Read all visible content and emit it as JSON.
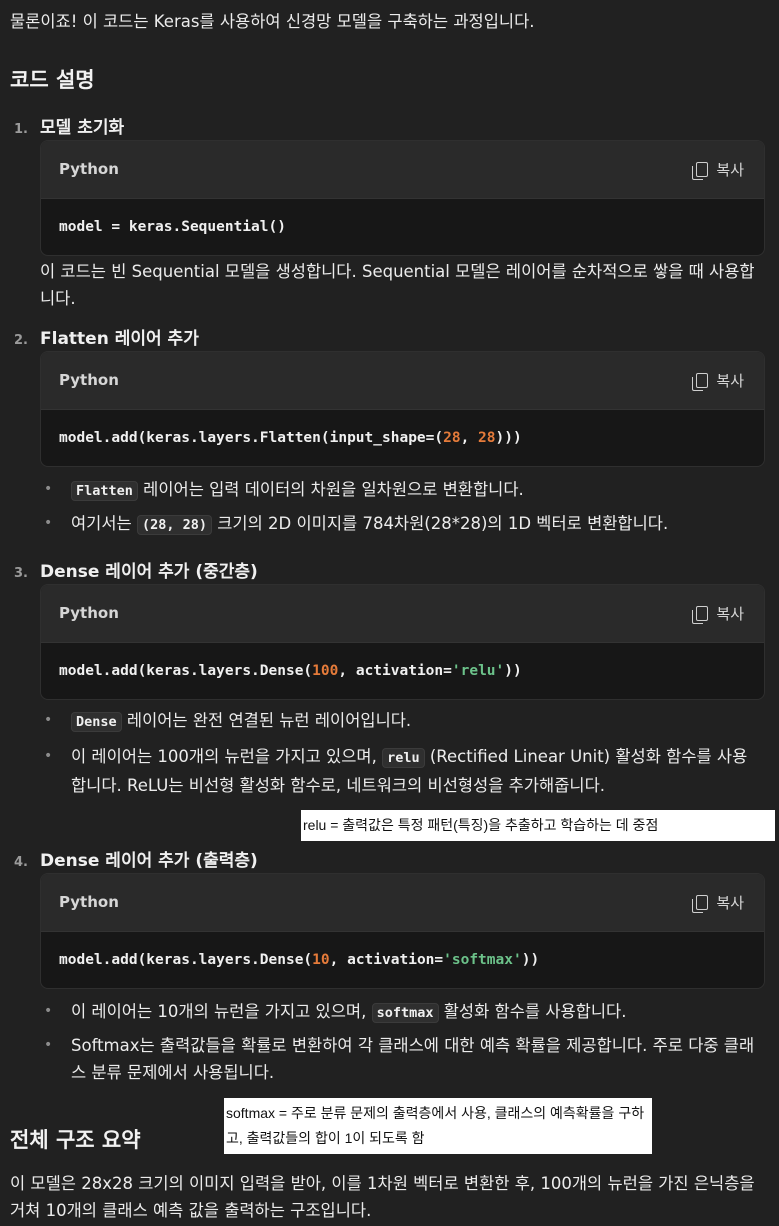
{
  "intro": "물론이죠! 이 코드는 Keras를 사용하여 신경망 모델을 구축하는 과정입니다.",
  "section_code_title": "코드 설명",
  "steps": [
    {
      "num": "1.",
      "title": "모델 초기화",
      "code_lang": "Python",
      "copy_label": "복사",
      "code": "model = keras.Sequential()",
      "desc": "이 코드는 빈 Sequential 모델을 생성합니다. Sequential 모델은 레이어를 순차적으로 쌓을 때 사용합니다."
    },
    {
      "num": "2.",
      "title": "Flatten 레이어 추가",
      "code_lang": "Python",
      "copy_label": "복사",
      "code_prefix": "model.add(keras.layers.Flatten(input_shape=(",
      "code_num1": "28",
      "code_mid": ", ",
      "code_num2": "28",
      "code_suffix": ")))",
      "bullets": [
        {
          "code": "Flatten",
          "text": " 레이어는 입력 데이터의 차원을 일차원으로 변환합니다."
        },
        {
          "pre": "여기서는 ",
          "code": "(28, 28)",
          "text": " 크기의 2D 이미지를 784차원(28*28)의 1D 벡터로 변환합니다."
        }
      ]
    },
    {
      "num": "3.",
      "title": "Dense 레이어 추가 (중간층)",
      "code_lang": "Python",
      "copy_label": "복사",
      "code_prefix": "model.add(keras.layers.Dense(",
      "code_num": "100",
      "code_mid": ", activation=",
      "code_str": "'relu'",
      "code_suffix": "))",
      "bullets": [
        {
          "code": "Dense",
          "text": " 레이어는 완전 연결된 뉴런 레이어입니다."
        },
        {
          "pre": "이 레이어는 100개의 뉴런을 가지고 있으며, ",
          "code": "relu",
          "text": " (Rectified Linear Unit) 활성화 함수를 사용합니다. ReLU는 비선형 활성화 함수로, 네트워크의 비선형성을 추가해줍니다."
        }
      ],
      "note": "relu = 출력값은 특정 패턴(특징)을 추출하고 학습하는 데 중점"
    },
    {
      "num": "4.",
      "title": "Dense 레이어 추가 (출력층)",
      "code_lang": "Python",
      "copy_label": "복사",
      "code_prefix": "model.add(keras.layers.Dense(",
      "code_num": "10",
      "code_mid": ", activation=",
      "code_str": "'softmax'",
      "code_suffix": "))",
      "bullets": [
        {
          "pre": "이 레이어는 10개의 뉴런을 가지고 있으며, ",
          "code": "softmax",
          "text": " 활성화 함수를 사용합니다."
        },
        {
          "text": "Softmax는 출력값들을 확률로 변환하여 각 클래스에 대한 예측 확률을 제공합니다. 주로 다중 클래스 분류 문제에서 사용됩니다."
        }
      ]
    }
  ],
  "summary_title": "전체 구조 요약",
  "summary_note": "softmax = 주로 분류 문제의 출력층에서 사용, 클래스의 예측확률을 구하고, 출력값들의 합이 1이 되도록 함",
  "summary_text": "이 모델은 28x28 크기의 이미지 입력을 받아, 이를 1차원 벡터로 변환한 후, 100개의 뉴런을 가진 은닉층을 거쳐 10개의 클래스 예측 값을 출력하는 구조입니다.",
  "bullet_char": "•"
}
